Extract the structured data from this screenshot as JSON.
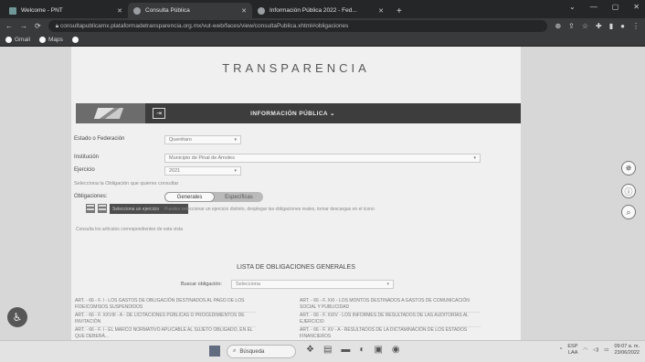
{
  "browser": {
    "tabs": [
      {
        "title": "Welcome - PNT",
        "active": false
      },
      {
        "title": "Consulta Pública",
        "active": true
      },
      {
        "title": "Información Pública 2022 - Fed...",
        "active": false
      }
    ],
    "new_tab": "+",
    "url": "consultapublicamx.plataformadetransparencia.org.mx/vut-web/faces/view/consultaPublica.xhtml#obligaciones",
    "bookmarks": [
      {
        "label": "Gmail",
        "icon": "gmail-icon"
      },
      {
        "label": "Maps",
        "icon": "maps-icon"
      }
    ]
  },
  "site": {
    "brand": "TRANSPARENCIA",
    "info_title": "INFORMACIÓN PÚBLICA ⌄",
    "form": {
      "estado_label": "Estado o Federación",
      "estado_value": "Querétaro",
      "institucion_label": "Institución",
      "institucion_value": "Municipio de Pinal de Amoles",
      "ejercicio_label": "Ejercicio",
      "ejercicio_value": "2021",
      "selecciona_label": "Selecciona la Obligación que quieres consultar",
      "obligaciones_label": "Obligaciones:",
      "toggle_generales": "Generales",
      "toggle_especificas": "Específicas",
      "dark_button": "Selecciona un ejercicio",
      "help_text": "Puedes seleccionar un ejercicio distinto, desplegar las obligaciones reales, tomar descargas en el icono",
      "note_text": "Consulta los artículos correspondientes de esta vista"
    },
    "lista": {
      "title": "LISTA DE OBLIGACIONES GENERALES",
      "buscar_label": "Buscar obligación:",
      "buscar_placeholder": "Selecciona"
    },
    "articles_left": [
      "ART. - 66 - F. I - LOS GASTOS DE OBLIGACIÓN DESTINADOS AL PAGO DE LOS FIDEICOMISOS SUSPENDIDOS",
      "ART. - 66 - F. XXVIII - A - DE LICITACIONES PÚBLICAS O PROCEDIMIENTOS DE INVITACIÓN",
      "ART. - 66 - F. I - EL MARCO NORMATIVO APLICABLE AL SUJETO OBLIGADO, EN EL QUE DEBERÁ..."
    ],
    "articles_right": [
      "ART. - 66 - F. XXI - LOS MONTOS DESTINADOS A GASTOS DE COMUNICACIÓN SOCIAL Y PUBLICIDAD",
      "ART. - 66 - F. XXIV - LOS INFORMES DE RESULTADOS DE LAS AUDITORÍAS AL EJERCICIO",
      "ART. - 66 - F. XV - A - RESULTADOS DE LA DICTAMINACIÓN DE LOS ESTADOS FINANCIEROS"
    ]
  },
  "taskbar": {
    "search_label": "Búsqueda",
    "lang_top": "ESP",
    "lang_bottom": "LAA",
    "time": "09:07 a. m.",
    "date": "23/06/2022"
  }
}
